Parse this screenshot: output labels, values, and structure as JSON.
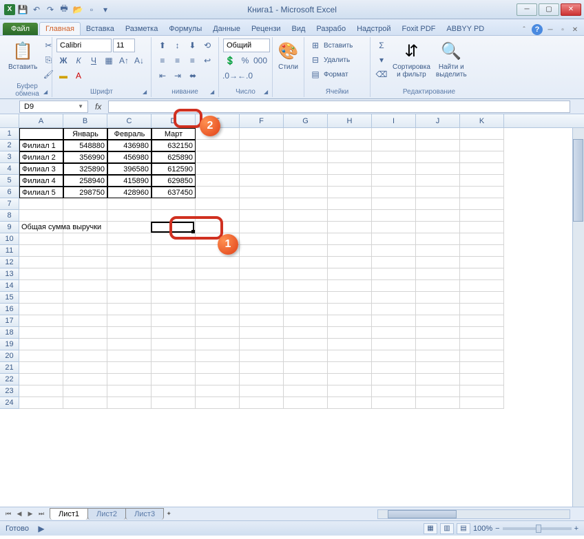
{
  "title": "Книга1 - Microsoft Excel",
  "qat_icons": [
    "excel",
    "save",
    "undo",
    "redo",
    "print",
    "open",
    "new",
    "preview"
  ],
  "tabs": {
    "file": "Файл",
    "list": [
      "Главная",
      "Вставка",
      "Разметка",
      "Формулы",
      "Данные",
      "Рецензи",
      "Вид",
      "Разрабо",
      "Надстрой",
      "Foxit PDF",
      "ABBYY PD"
    ],
    "active_index": 0
  },
  "ribbon": {
    "clipboard": {
      "label": "Буфер обмена",
      "paste": "Вставить"
    },
    "font": {
      "label": "Шрифт",
      "name": "Calibri",
      "size": "11"
    },
    "align": {
      "label": "нивание"
    },
    "number": {
      "label": "Число",
      "format": "Общий"
    },
    "styles": {
      "label": "Стили",
      "btn": "Стили"
    },
    "cells": {
      "label": "Ячейки",
      "insert": "Вставить",
      "delete": "Удалить",
      "format": "Формат"
    },
    "editing": {
      "label": "Редактирование",
      "sort": "Сортировка\nи фильтр",
      "find": "Найти и\nвыделить"
    }
  },
  "namebox": "D9",
  "columns": [
    "A",
    "B",
    "C",
    "D",
    "E",
    "F",
    "G",
    "H",
    "I",
    "J",
    "K"
  ],
  "row_count": 24,
  "data": {
    "headers": [
      "",
      "Январь",
      "Февраль",
      "Март"
    ],
    "rows": [
      [
        "Филиал 1",
        "548880",
        "436980",
        "632150"
      ],
      [
        "Филиал 2",
        "356990",
        "456980",
        "625890"
      ],
      [
        "Филиал 3",
        "325890",
        "396580",
        "612590"
      ],
      [
        "Филиал 4",
        "258940",
        "415890",
        "629850"
      ],
      [
        "Филиал 5",
        "298750",
        "428960",
        "637450"
      ]
    ],
    "label_row9": "Общая сумма выручки"
  },
  "chart_data": {
    "type": "table",
    "title": "",
    "categories": [
      "Январь",
      "Февраль",
      "Март"
    ],
    "series": [
      {
        "name": "Филиал 1",
        "values": [
          548880,
          436980,
          632150
        ]
      },
      {
        "name": "Филиал 2",
        "values": [
          356990,
          456980,
          625890
        ]
      },
      {
        "name": "Филиал 3",
        "values": [
          325890,
          396580,
          612590
        ]
      },
      {
        "name": "Филиал 4",
        "values": [
          258940,
          415890,
          629850
        ]
      },
      {
        "name": "Филиал 5",
        "values": [
          298750,
          428960,
          637450
        ]
      }
    ]
  },
  "sheets": {
    "list": [
      "Лист1",
      "Лист2",
      "Лист3"
    ],
    "active_index": 0
  },
  "status": {
    "ready": "Готово",
    "zoom": "100%"
  },
  "annotations": {
    "badge1": "1",
    "badge2": "2"
  }
}
